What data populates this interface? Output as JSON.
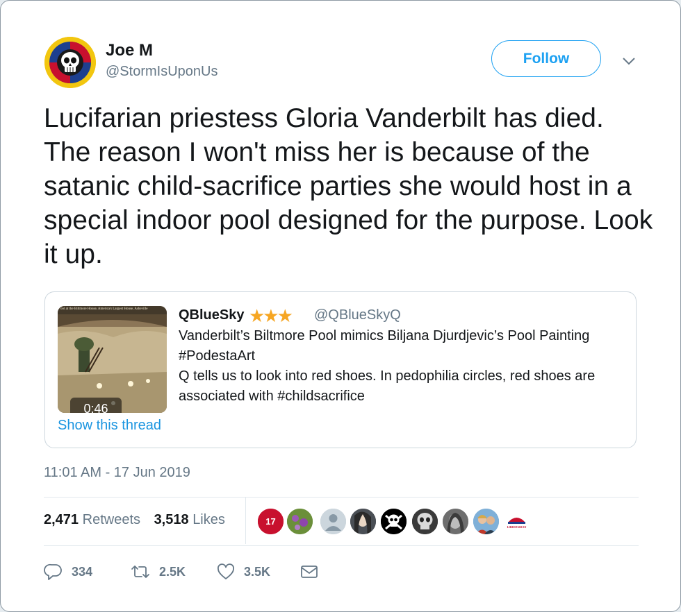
{
  "author": {
    "name": "Joe M",
    "handle": "@StormIsUponUs",
    "avatar_icon": "skull-badge-icon"
  },
  "follow_label": "Follow",
  "tweet_text": "Lucifarian priestess Gloria Vanderbilt has died. The reason I won't miss her is because of the satanic child-sacrifice parties she would host in a special indoor pool designed for the purpose. Look it up.",
  "quoted_tweet": {
    "name": "QBlueSky",
    "stars": "★★★",
    "handle": "@QBlueSkyQ",
    "thumbnail_caption": "ool at the Biltmore House, America's Largest House, Asheville",
    "video_duration": "0:46",
    "text": "Vanderbilt’s Biltmore Pool mimics Biljana Djurdjevic’s Pool Painting #PodestaArt\nQ tells us to look into red shoes.  In pedophilia circles, red shoes are associated with #childsacrifice",
    "show_thread": "Show this thread"
  },
  "timestamp": "11:01 AM - 17 Jun 2019",
  "stats": {
    "retweets_count": "2,471",
    "retweets_label": "Retweets",
    "likes_count": "3,518",
    "likes_label": "Likes"
  },
  "liked_by_avatars": [
    {
      "icon": "jersey-avatar-icon",
      "badge": "17",
      "color": "#c8102e"
    },
    {
      "icon": "flowers-avatar-icon",
      "color": "#6b8f3a"
    },
    {
      "icon": "default-person-avatar-icon",
      "color": "#b8c3cc"
    },
    {
      "icon": "portrait-avatar-icon",
      "color": "#4a4f55"
    },
    {
      "icon": "skull-crossbones-avatar-icon",
      "color": "#000000"
    },
    {
      "icon": "skull-avatar-icon",
      "color": "#2e2e2e"
    },
    {
      "icon": "bw-portrait-avatar-icon",
      "color": "#8a8a8a"
    },
    {
      "icon": "couple-avatar-icon",
      "color": "#6fa0c8"
    },
    {
      "icon": "libertarian-logo-avatar-icon",
      "badge": "LIBERTARIAN",
      "color": "#c8102e"
    }
  ],
  "actions": {
    "replies": "334",
    "retweets": "2.5K",
    "likes": "3.5K"
  },
  "colors": {
    "accent": "#1da1f2",
    "link": "#1b95e0",
    "secondary_text": "#657786",
    "star": "#f6a623"
  }
}
